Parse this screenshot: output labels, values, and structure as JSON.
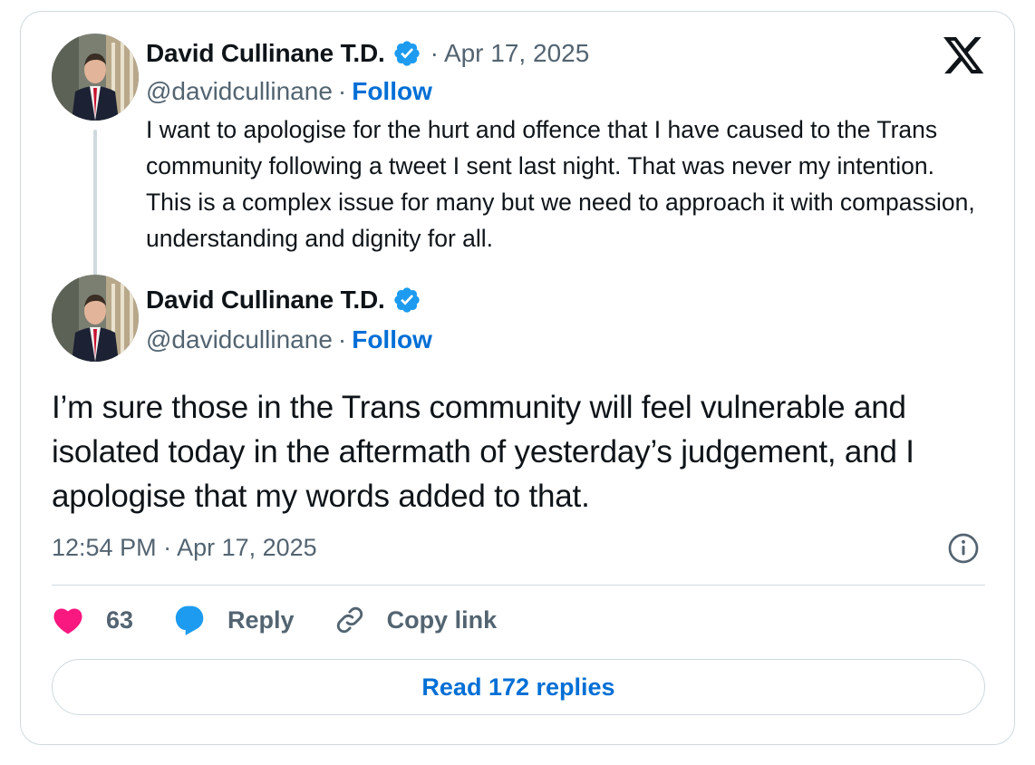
{
  "colors": {
    "link": "#006fd6",
    "secondary_text": "#536471",
    "border": "#cfd9de",
    "verified": "#1d9bf0",
    "heart": "#f91880"
  },
  "quoted_tweet": {
    "author_name": "David Cullinane T.D.",
    "separator": "·",
    "date": "Apr 17, 2025",
    "handle": "@davidcullinane",
    "follow_label": "Follow",
    "text": "I want to apologise for the hurt and offence that I have caused to the Trans community following a tweet I sent last night. That was never my intention. This is a complex issue for many but we need to approach it with compassion, understanding and dignity for all.",
    "avatar_icon": "profile-photo"
  },
  "main_tweet": {
    "author_name": "David Cullinane T.D.",
    "handle": "@davidcullinane",
    "separator": "·",
    "follow_label": "Follow",
    "text": "I’m sure those in the Trans community will feel vulnerable and isolated today in the aftermath of yesterday’s judgement, and I apologise that my words added to that.",
    "timestamp": "12:54 PM · Apr 17, 2025",
    "avatar_icon": "profile-photo"
  },
  "actions": {
    "like_count": "63",
    "reply_label": "Reply",
    "copy_link_label": "Copy link",
    "like_icon": "heart-icon",
    "reply_icon": "speech-bubble-icon",
    "copy_icon": "link-icon"
  },
  "read_replies_label": "Read 172 replies",
  "brand_icon": "x-logo-icon",
  "info_icon": "info-icon"
}
